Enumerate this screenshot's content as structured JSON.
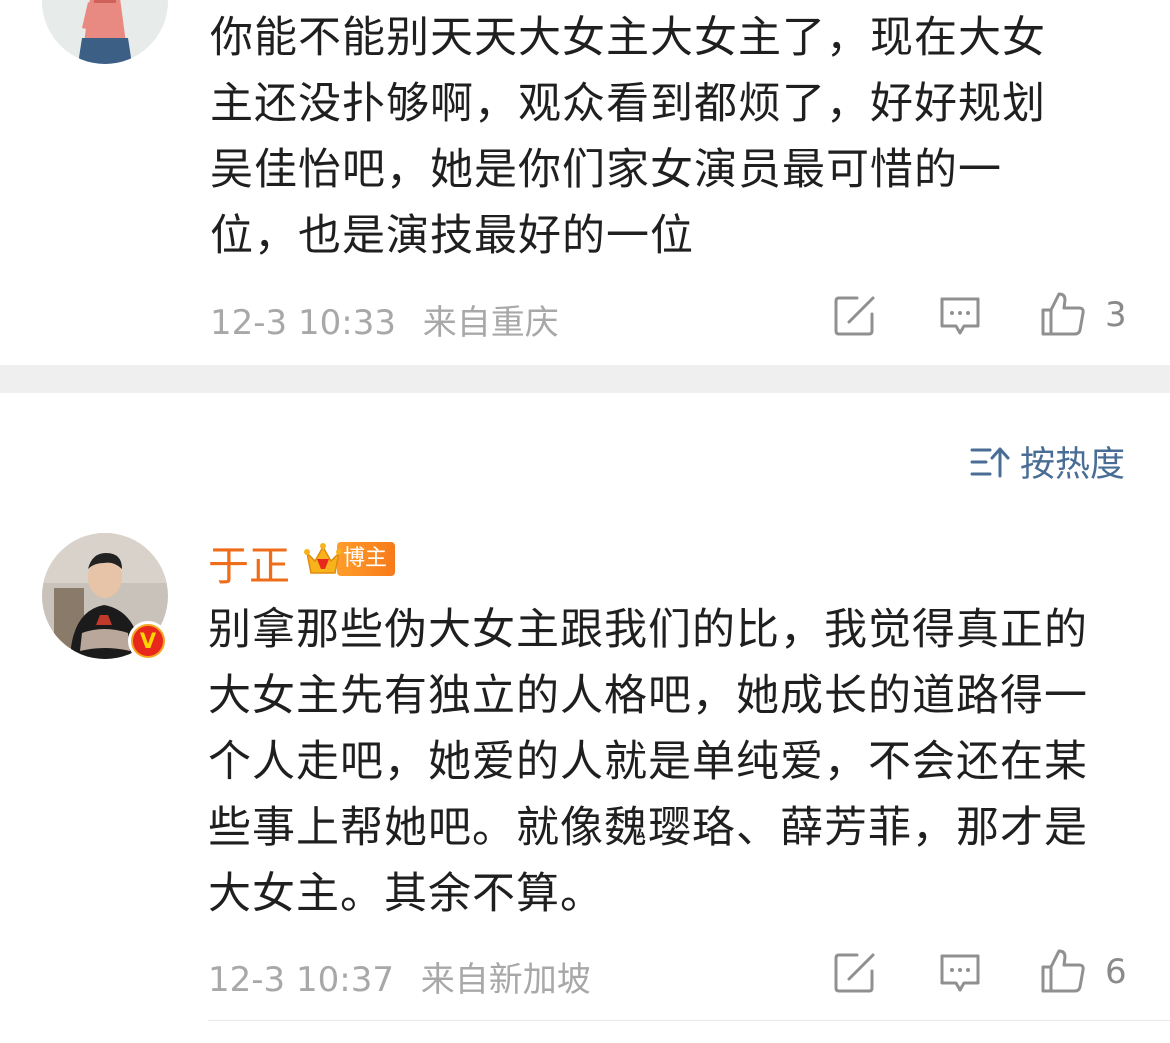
{
  "comment1": {
    "lines": [
      "你能不能别天天大女主大女主了，现在大女",
      "主还没扑够啊，观众看到都烦了，好好规划",
      "吴佳怡吧，她是你们家女演员最可惜的一",
      "位，也是演技最好的一位"
    ],
    "time": "12-3 10:33",
    "location": "来自重庆",
    "likes": "3"
  },
  "sort": {
    "label": "按热度",
    "icon": "sort-icon"
  },
  "comment2": {
    "username": "于正",
    "badge_label": "博主",
    "verified_mark": "V",
    "lines": [
      "别拿那些伪大女主跟我们的比，我觉得真正的",
      "大女主先有独立的人格吧，她成长的道路得一",
      "个人走吧，她爱的人就是单纯爱，不会还在某",
      "些事上帮她吧。就像魏璎珞、薛芳菲，那才是",
      "大女主。其余不算。"
    ],
    "time": "12-3 10:37",
    "location": "来自新加坡",
    "likes": "6"
  },
  "colors": {
    "username": "#ef6c1a",
    "sort_link": "#4a6d96",
    "meta": "#a8a8a8",
    "divider": "#efefef"
  }
}
